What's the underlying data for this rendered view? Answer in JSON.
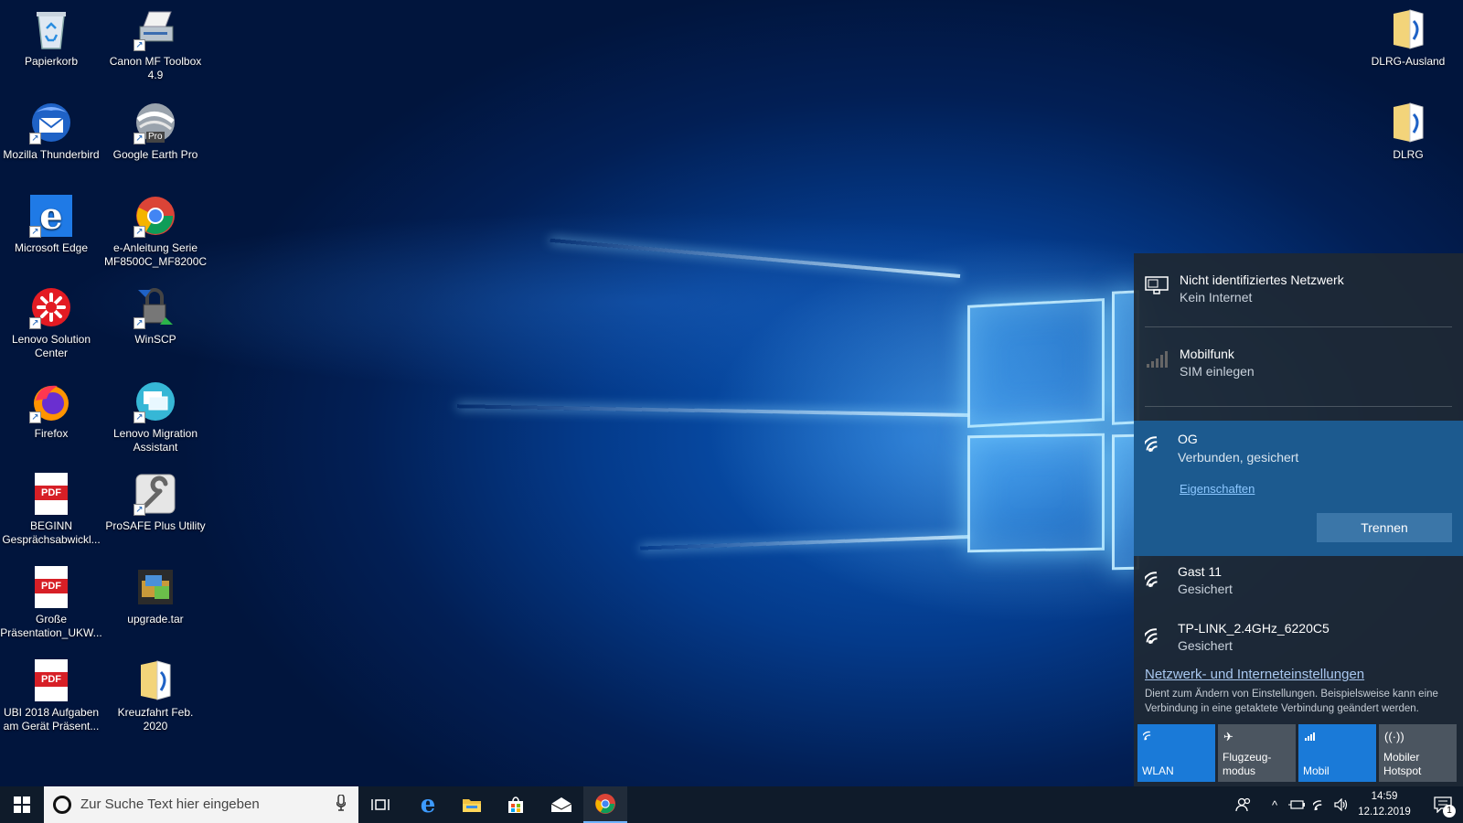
{
  "desktop": {
    "icons": {
      "papierkorb": "Papierkorb",
      "canon": "Canon MF Toolbox 4.9",
      "thunderbird": "Mozilla Thunderbird",
      "google_earth": "Google Earth Pro",
      "edge": "Microsoft Edge",
      "e_anleitung": "e-Anleitung Serie MF8500C_MF8200C",
      "lenovo_solution": "Lenovo Solution Center",
      "winscp": "WinSCP",
      "firefox": "Firefox",
      "lenovo_migration": "Lenovo Migration Assistant",
      "beginn": "BEGINN Gesprächsabwickl...",
      "prosafe": "ProSAFE Plus Utility",
      "grosse": "Große Präsentation_UKW...",
      "upgrade": "upgrade.tar",
      "ubi": "UBI 2018 Aufgaben am Gerät Präsent...",
      "kreuzfahrt": "Kreuzfahrt Feb. 2020",
      "dlrg_ausland": "DLRG-Ausland",
      "dlrg": "DLRG"
    },
    "pdf_label": "PDF",
    "pro_label": "Pro"
  },
  "network_flyout": {
    "ethernet": {
      "title": "Nicht identifiziertes Netzwerk",
      "status": "Kein Internet",
      "icon": "ethernet-icon"
    },
    "mobile": {
      "title": "Mobilfunk",
      "status": "SIM einlegen",
      "icon": "cellular-signal-icon"
    },
    "connected": {
      "title": "OG",
      "status": "Verbunden, gesichert",
      "properties_link": "Eigenschaften",
      "disconnect_button": "Trennen",
      "icon": "wifi-icon"
    },
    "networks": [
      {
        "title": "Gast 11",
        "status": "Gesichert"
      },
      {
        "title": "TP-LINK_2.4GHz_6220C5",
        "status": "Gesichert"
      }
    ],
    "settings_link": "Netzwerk- und Interneteinstellungen",
    "settings_desc": "Dient zum Ändern von Einstellungen. Beispielsweise kann eine Verbindung in eine getaktete Verbindung geändert werden.",
    "tiles": [
      {
        "label": "WLAN",
        "state": "on"
      },
      {
        "label": "Flugzeug-\nmodus",
        "state": "off"
      },
      {
        "label": "Mobil",
        "state": "on"
      },
      {
        "label": "Mobiler\nHotspot",
        "state": "off"
      }
    ]
  },
  "taskbar": {
    "search_placeholder": "Zur Suche Text hier eingeben",
    "time": "14:59",
    "date": "12.12.2019",
    "notification_count": "1"
  },
  "colors": {
    "accent": "#1a7ad8",
    "flyout_bg": "#1e2834",
    "connected_bg": "#1c5a8f",
    "taskbar_bg": "#0f1b2a"
  }
}
